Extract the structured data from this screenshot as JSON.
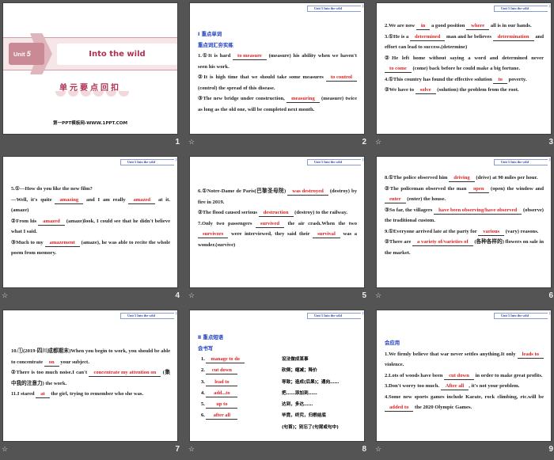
{
  "badge": "Unit 5   Into the wild",
  "star_icon": "☆",
  "slide1": {
    "unit": "Unit",
    "unit_num": "5",
    "title": "Into the wild",
    "subtitle": "单元要点回扣",
    "footer": "第一PPT模板网-WWW.1PPT.COM",
    "number": "1"
  },
  "slides": [
    {
      "number": "2",
      "paras": [
        [
          {
            "h": "Ⅰ  重点单词"
          }
        ],
        [
          {
            "h": "重点词汇夯实练"
          }
        ],
        [
          "1.①It is hard ",
          {
            "a": "to measure"
          },
          " (measure) his ability when we haven't seen his work."
        ],
        [
          "②It is high time that we should take some measures ",
          {
            "a": "to control"
          },
          " (control) the spread of this disease."
        ],
        [
          "③The new bridge under construction, ",
          {
            "a": "measuring"
          },
          " (measure) twice as long as the old one, will be completed next month."
        ]
      ]
    },
    {
      "number": "3",
      "paras": [
        [
          "2.We are now ",
          {
            "a": "in"
          },
          " a good position ",
          {
            "a": "where"
          },
          " all is in our hands."
        ],
        [
          "3.①He is a ",
          {
            "a": "determined"
          },
          " man and he believes ",
          {
            "a": "determination"
          },
          " and effort can lead to success.(determine)"
        ],
        [
          "②He left home without saying a word and determined never ",
          {
            "a": "to come"
          },
          " (come) back before he could make a big fortune."
        ],
        [
          "4.①This country has found the effective solution ",
          {
            "a": "to"
          },
          " poverty."
        ],
        [
          "②We have to ",
          {
            "a": "solve"
          },
          " (solution) the problem from the root."
        ]
      ]
    },
    {
      "number": "4",
      "paras": [
        [
          "5.①—How do you like the new film?"
        ],
        [
          "—Well, it's quite ",
          {
            "a": "amazing"
          },
          " and I am really ",
          {
            "a": "amazed"
          },
          " at it.(amaze)"
        ],
        [
          "②From his ",
          {
            "a": "amazed"
          },
          " (amaze)look, I could see that he didn't believe what I said."
        ],
        [
          "③Much to my ",
          {
            "a": "amazement"
          },
          " (amaze), he was able to recite the whole poem from memory."
        ]
      ]
    },
    {
      "number": "5",
      "paras": [
        [
          "6.①Notre-Dame de Paris(巴黎圣母院) ",
          {
            "a": "was destroyed"
          },
          " (destroy) by fire in 2019."
        ],
        [
          "②The flood caused serious ",
          {
            "a": "destruction"
          },
          " (destroy) to the railway."
        ],
        [
          "7.Only two passengers ",
          {
            "a": "survived"
          },
          " the air crash.When the two ",
          {
            "a": "survivors"
          },
          " were interviewed, they said their ",
          {
            "a": "survival"
          },
          " was a wonder.(survive)"
        ]
      ]
    },
    {
      "number": "6",
      "paras": [
        [
          "8.①The police observed him ",
          {
            "a": "driving"
          },
          " (drive) at 90 miles per hour."
        ],
        [
          "②The policeman observed the man ",
          {
            "a": "open"
          },
          " (open) the window and ",
          {
            "a": "enter"
          },
          " (enter) the house."
        ],
        [
          "③So far, the villagers ",
          {
            "a": "have been observing/have observed"
          },
          " (observe) the traditional custom."
        ],
        [
          "9.①Everyone arrived late at the party for ",
          {
            "a": "various"
          },
          " (vary) reasons."
        ],
        [
          "②There are ",
          {
            "a": "a variety of/varieties of"
          },
          " (各种各样的) flowers on sale in the market."
        ]
      ]
    },
    {
      "number": "7",
      "paras": [
        [
          "10.①(2019·四川成都期末)When you begin to work, you should be able to concentrate ",
          {
            "a": "on"
          },
          " your subject."
        ],
        [
          "②There is too much noise.I can't ",
          {
            "a": "concentrate my attention on"
          },
          " (集中我的注意力) the work."
        ],
        [
          "11.I stared ",
          {
            "a": "at"
          },
          " the girl, trying to remember who she was."
        ]
      ]
    },
    {
      "number": "8",
      "special": true,
      "heading": "Ⅱ  重点短语",
      "sub": "会书写",
      "items": [
        "manage to do",
        "cut down",
        "lead to",
        "add...to",
        "up to",
        "after all"
      ],
      "meanings": [
        "设法做成某事",
        "砍倒；缩减；降价",
        "导致；造成(后果)；通向……",
        "把……添加到……",
        "达到，多达……",
        "毕竟，终究，归根结底",
        "(句首)；别忘了(句尾或句中)"
      ]
    },
    {
      "number": "9",
      "paras": [
        [
          {
            "h": "会应用"
          }
        ],
        [
          "1.We firmly believe that war never settles anything.It only ",
          {
            "a": "leads to"
          },
          " violence."
        ],
        [
          "2.Lots of woods have been ",
          {
            "a": "cut down"
          },
          " in order to make great profits."
        ],
        [
          "3.Don't worry too much. ",
          {
            "a": "After all"
          },
          ", it's not your problem."
        ],
        [
          "4.Some new sports games include Karate, rock climbing, etc.will be ",
          {
            "a": "added to"
          },
          " the 2020 Olympic Games."
        ]
      ]
    }
  ]
}
